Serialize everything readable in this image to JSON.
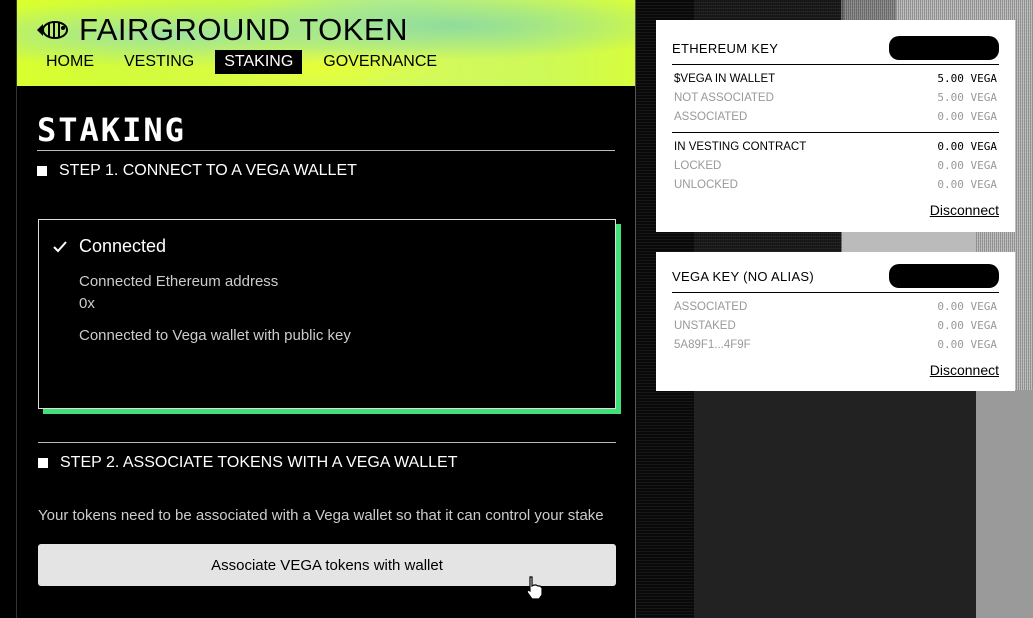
{
  "app": {
    "title": "FAIRGROUND TOKEN"
  },
  "nav": [
    {
      "label": "HOME",
      "active": false
    },
    {
      "label": "VESTING",
      "active": false
    },
    {
      "label": "STAKING",
      "active": true
    },
    {
      "label": "GOVERNANCE",
      "active": false
    }
  ],
  "page": {
    "title": "STAKING"
  },
  "step1": {
    "label": "STEP 1. CONNECT TO A VEGA WALLET",
    "status": "Connected",
    "eth_label": "Connected Ethereum address",
    "eth_value": "0x",
    "vega_label": "Connected to Vega wallet with public key"
  },
  "step2": {
    "label": "STEP 2. ASSOCIATE TOKENS WITH A VEGA WALLET",
    "description": "Your tokens need to be associated with a Vega wallet so that it can control your stake",
    "button": "Associate VEGA tokens with wallet"
  },
  "eth_card": {
    "title": "ETHEREUM KEY",
    "rows1": [
      {
        "label": "$VEGA IN WALLET",
        "value": "5.00 VEGA"
      },
      {
        "label": "NOT ASSOCIATED",
        "value": "5.00 VEGA"
      },
      {
        "label": "ASSOCIATED",
        "value": "0.00 VEGA"
      }
    ],
    "rows2": [
      {
        "label": "IN VESTING CONTRACT",
        "value": "0.00 VEGA"
      },
      {
        "label": "LOCKED",
        "value": "0.00 VEGA"
      },
      {
        "label": "UNLOCKED",
        "value": "0.00 VEGA"
      }
    ],
    "disconnect": "Disconnect"
  },
  "vega_card": {
    "title": "VEGA KEY (NO ALIAS)",
    "rows": [
      {
        "label": "ASSOCIATED",
        "value": "0.00 VEGA"
      },
      {
        "label": "UNSTAKED",
        "value": "0.00 VEGA"
      },
      {
        "label": "5A89F1...4F9F",
        "value": "0.00 VEGA"
      }
    ],
    "disconnect": "Disconnect"
  },
  "colors": {
    "accent_green": "#42e07b",
    "header_yellow": "#d9ff2e"
  }
}
